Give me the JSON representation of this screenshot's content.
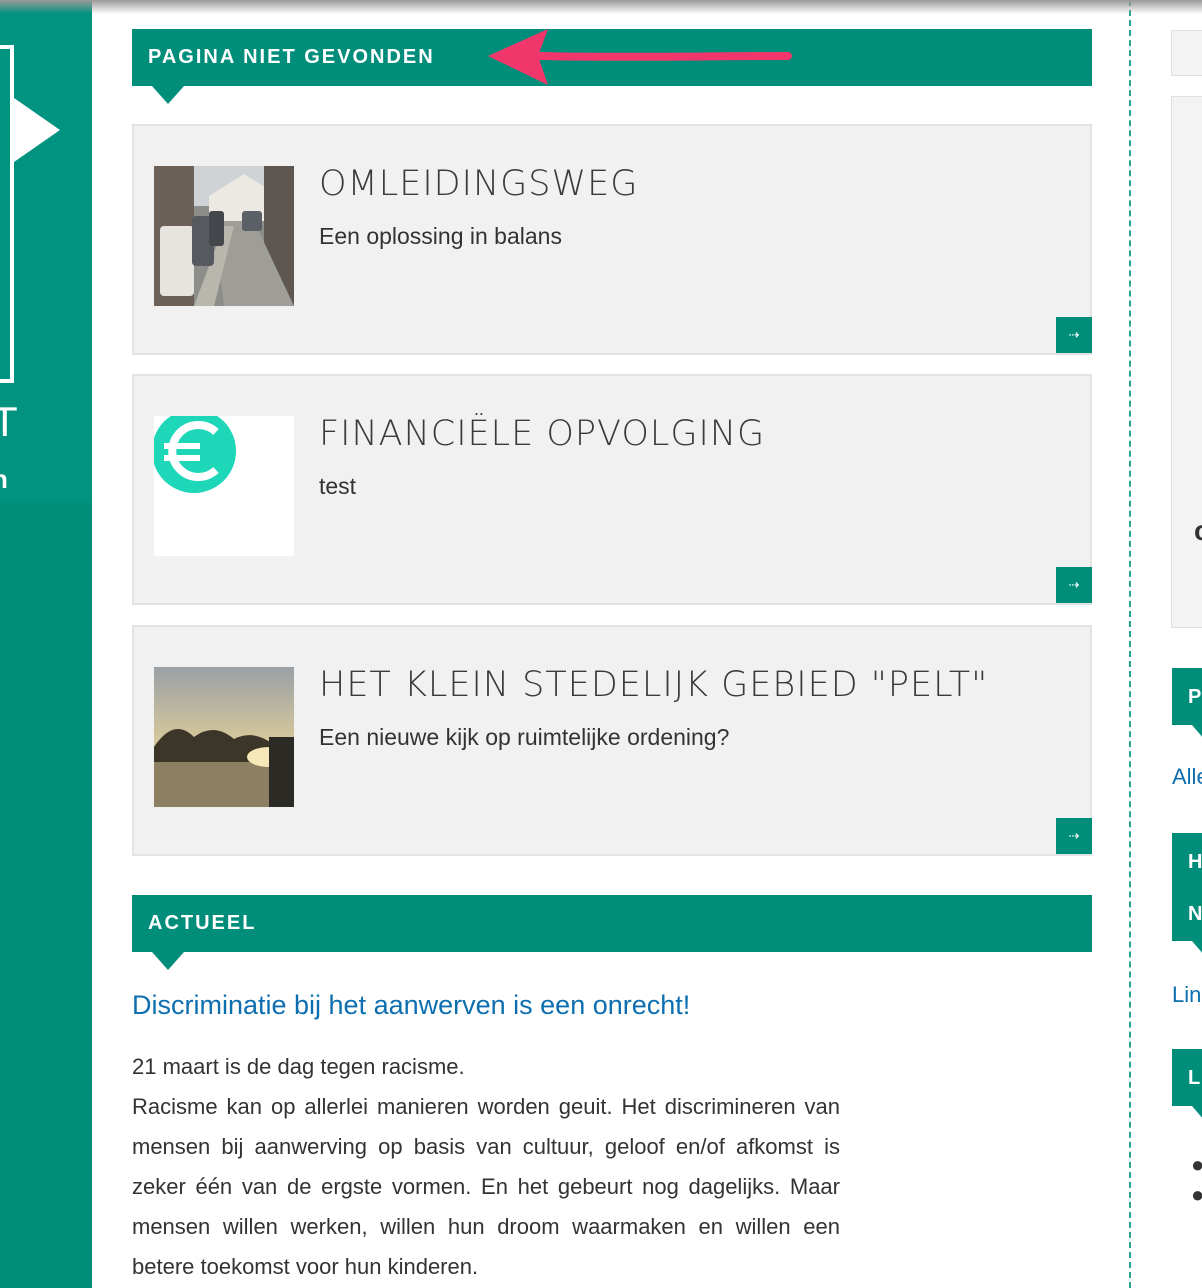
{
  "sidebar_left": {
    "letter": "T",
    "sub": "n"
  },
  "main": {
    "section_title": "PAGINA NIET GEVONDEN",
    "cards": [
      {
        "title": "OMLEIDINGSWEG",
        "subtitle": "Een oplossing in balans",
        "more_icon": "⇢"
      },
      {
        "title": "FINANCIËLE OPVOLGING",
        "subtitle": "test",
        "more_icon": "⇢"
      },
      {
        "title": "HET KLEIN STEDELIJK GEBIED \"PELT\"",
        "subtitle": "Een nieuwe kijk op ruimtelijke ordening?",
        "more_icon": "⇢"
      }
    ],
    "news_title": "ACTUEEL",
    "article": {
      "title": "Discriminatie bij het aanwerven is een onrecht!",
      "line1": "21 maart is de dag tegen racisme.",
      "body": "Racisme kan op allerlei manieren worden geuit. Het discrimineren van mensen bij aanwerving op basis van cultuur, geloof en/of afkomst is zeker één van de ergste vormen. En het gebeurt nog dagelijks. Maar mensen willen werken, willen hun droom waarmaken en willen een betere toekomst voor hun kinderen."
    }
  },
  "right": {
    "box_fragment": "c",
    "head1": "P",
    "link1": "Alle",
    "head2_line1": "H",
    "head2_line2": "N",
    "link2": "Lin",
    "head3": "L",
    "people_1": "●",
    "people_2": "●"
  },
  "colors": {
    "primary": "#008e7b",
    "card_bg": "#f1f1f1",
    "link": "#0d6fb0",
    "annotation_arrow": "#f1366b"
  },
  "icons": {
    "more": "arrow-right-icon",
    "euro": "euro-icon"
  }
}
